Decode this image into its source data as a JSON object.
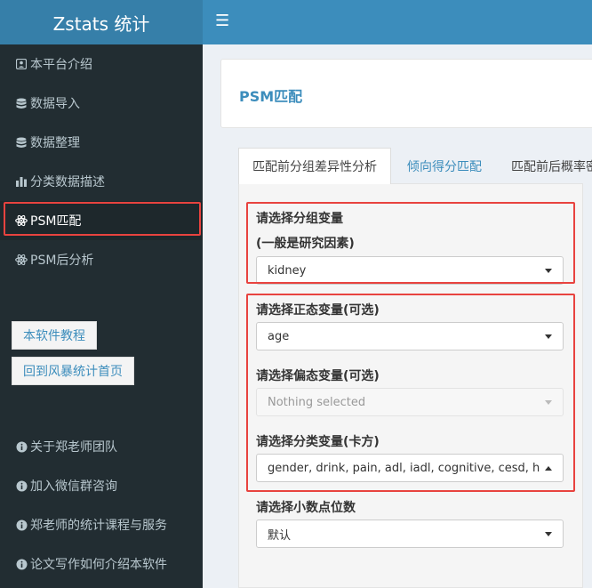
{
  "app": {
    "title": "Zstats 统计"
  },
  "topbar": {
    "menu_icon": "hamburger-icon"
  },
  "sidebar": {
    "items": [
      {
        "label": "本平台介绍",
        "icon": "id-card-icon"
      },
      {
        "label": "数据导入",
        "icon": "database-icon"
      },
      {
        "label": "数据整理",
        "icon": "database-icon"
      },
      {
        "label": "分类数据描述",
        "icon": "bar-chart-icon"
      },
      {
        "label": "PSM匹配",
        "icon": "atom-icon",
        "active": true
      },
      {
        "label": "PSM后分析",
        "icon": "atom-icon"
      }
    ],
    "buttons": {
      "tutorial": "本软件教程",
      "home": "回到风暴统计首页"
    },
    "links": [
      {
        "label": "关于郑老师团队",
        "icon": "info-icon"
      },
      {
        "label": "加入微信群咨询",
        "icon": "info-icon"
      },
      {
        "label": "郑老师的统计课程与服务",
        "icon": "info-icon"
      },
      {
        "label": "论文写作如何介绍本软件",
        "icon": "info-icon"
      }
    ]
  },
  "main": {
    "title": "PSM匹配",
    "tabs": [
      {
        "label": "匹配前分组差异性分析",
        "active": true
      },
      {
        "label": "倾向得分匹配"
      },
      {
        "label": "匹配前后概率密"
      }
    ],
    "form": {
      "group_label": "请选择分组变量",
      "group_hint": "(一般是研究因素)",
      "group_value": "kidney",
      "normal_label": "请选择正态变量(可选)",
      "normal_value": "age",
      "skewed_label": "请选择偏态变量(可选)",
      "skewed_placeholder": "Nothing selected",
      "categorical_label": "请选择分类变量(卡方)",
      "categorical_value": "gender, drink, pain, adl, iadl, cognitive, cesd, hypertension",
      "decimal_label": "请选择小数点位数",
      "decimal_value": "默认"
    }
  },
  "colors": {
    "brand": "#367fa9",
    "topbar": "#3c8dbc",
    "sidebar": "#222d32",
    "highlight": "#e8433f",
    "link": "#3c8dbc"
  }
}
